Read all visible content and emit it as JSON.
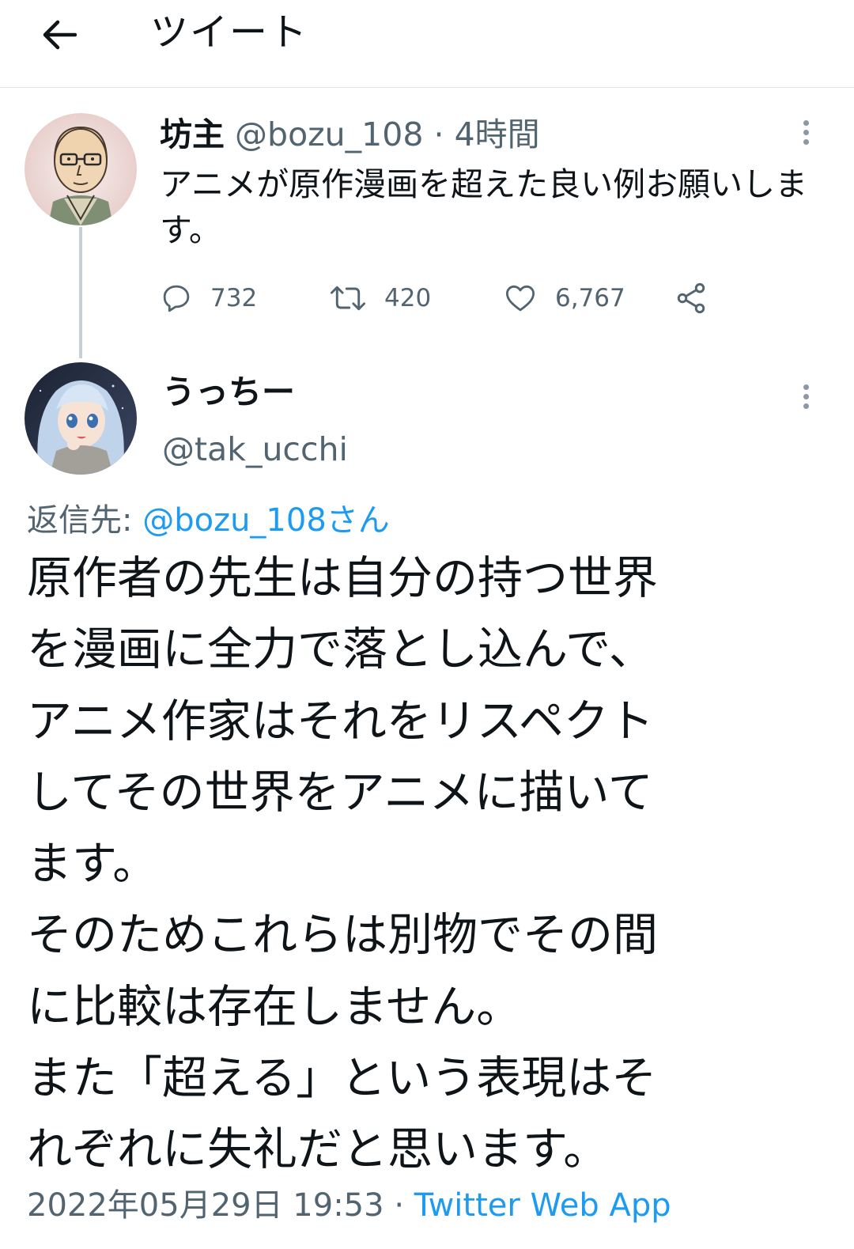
{
  "header": {
    "title": "ツイート"
  },
  "colors": {
    "link": "#1d9bf0",
    "muted": "#536471",
    "text": "#0f1419"
  },
  "tweet1": {
    "name": "坊主",
    "handle": "@bozu_108",
    "separator": "·",
    "time": "4時間",
    "text": "アニメが原作漫画を超えた良い例お願いします。",
    "replies": "732",
    "retweets": "420",
    "likes": "6,767"
  },
  "tweet2": {
    "name": "うっちー",
    "handle": "@tak_ucchi",
    "reply_label": "返信先:",
    "reply_target": "@bozu_108さん",
    "lines": [
      "原作者の先生は自分の持つ世界",
      "を漫画に全力で落とし込んで、",
      "アニメ作家はそれをリスペクト",
      "してその世界をアニメに描いて",
      "ます。",
      "そのためこれらは別物でその間",
      "に比較は存在しません。",
      "また「超える」という表現はそ",
      "れぞれに失礼だと思います。"
    ],
    "timestamp": "2022年05月29日 19:53",
    "separator": "·",
    "source": "Twitter Web App"
  }
}
